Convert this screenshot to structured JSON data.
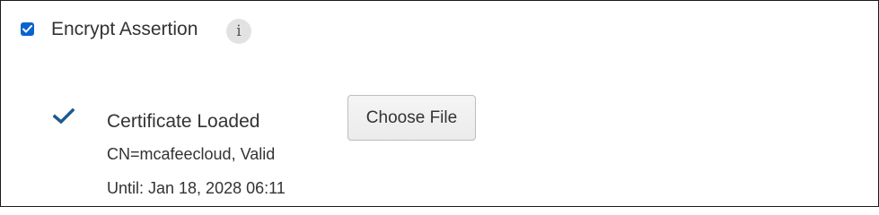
{
  "encrypt_assertion": {
    "label": "Encrypt Assertion",
    "checked": true,
    "info_icon": "info-icon",
    "info_glyph": "i"
  },
  "certificate": {
    "status_icon": "checkmark-icon",
    "title": "Certificate Loaded",
    "subject": "CN=mcafeecloud, Valid",
    "validity": "Until: Jan 18, 2028 06:11"
  },
  "upload": {
    "button_label": "Choose File"
  },
  "colors": {
    "checkbox": "#0b63ce",
    "checkmark": "#1f5a8e",
    "text": "#333333",
    "info_bg": "#e2e2e2"
  }
}
